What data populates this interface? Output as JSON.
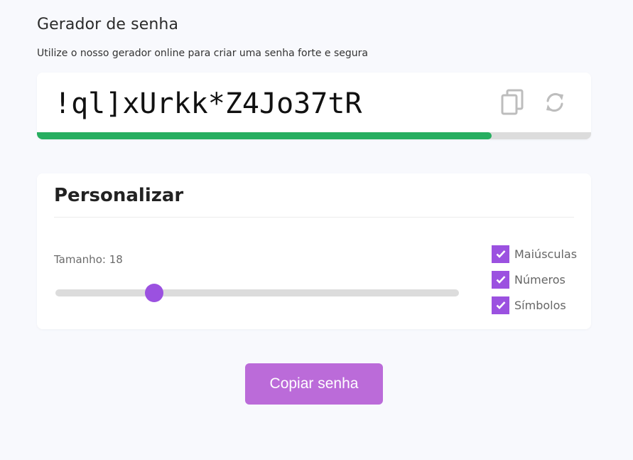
{
  "header": {
    "title": "Gerador de senha",
    "subtitle": "Utilize o nosso gerador online para criar uma senha forte e segura"
  },
  "password": {
    "value": "!ql]xUrkk*Z4Jo37tR",
    "strength_fraction": 0.82,
    "strength_color": "#27ae60",
    "copy_icon": "copy-icon",
    "refresh_icon": "refresh-icon"
  },
  "customize": {
    "title": "Personalizar",
    "length_label": "Tamanho: 18",
    "slider_position_fraction": 0.245,
    "accent_color": "#9b51e0",
    "options": [
      {
        "label": "Maiúsculas",
        "checked": true
      },
      {
        "label": "Números",
        "checked": true
      },
      {
        "label": "Símbolos",
        "checked": true
      }
    ]
  },
  "actions": {
    "copy_label": "Copiar senha",
    "button_color": "#bb6bd9"
  }
}
